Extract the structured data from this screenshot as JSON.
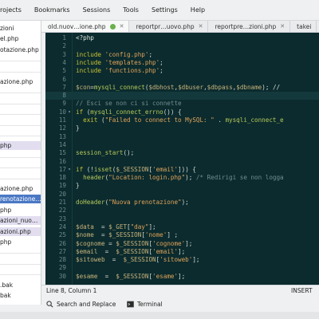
{
  "menu": [
    "rojects",
    "Bookmarks",
    "Sessions",
    "Tools",
    "Settings",
    "Help"
  ],
  "tabs": [
    {
      "label": "old.nuov…ione.php",
      "active": true,
      "modified": true
    },
    {
      "label": "reportpr…uovo.php",
      "active": false
    },
    {
      "label": "reportpre…zioni.php",
      "active": false
    },
    {
      "label": "takei",
      "active": false
    }
  ],
  "sidebar_files": [
    {
      "label": "zioni",
      "state": "normal"
    },
    {
      "label": "el.php",
      "state": "normal"
    },
    {
      "label": "otazione.php",
      "state": "normal"
    },
    {
      "label": "",
      "state": "sep"
    },
    {
      "label": "",
      "state": "sep"
    },
    {
      "label": "azione.php",
      "state": "normal"
    },
    {
      "label": "",
      "state": "sep"
    },
    {
      "label": "",
      "state": "sep"
    },
    {
      "label": "",
      "state": "sep"
    },
    {
      "label": "",
      "state": "sep"
    },
    {
      "label": "",
      "state": "sep"
    },
    {
      "label": "php",
      "state": "highlight"
    },
    {
      "label": "",
      "state": "sep"
    },
    {
      "label": "",
      "state": "sep"
    },
    {
      "label": "",
      "state": "sep"
    },
    {
      "label": "azione.php",
      "state": "normal"
    },
    {
      "label": "renotazione…",
      "state": "selected"
    },
    {
      "label": "php",
      "state": "normal"
    },
    {
      "label": "azioni_nuo…",
      "state": "highlight"
    },
    {
      "label": "azioni.php",
      "state": "highlight"
    },
    {
      "label": "php",
      "state": "normal"
    },
    {
      "label": "",
      "state": "sep"
    },
    {
      "label": "",
      "state": "sep"
    },
    {
      "label": "",
      "state": "sep"
    },
    {
      "label": ".bak",
      "state": "normal"
    },
    {
      "label": "bak",
      "state": "normal"
    }
  ],
  "code_lines": [
    {
      "n": "1",
      "fold": "",
      "tokens": [
        [
          "<?php",
          "pl"
        ]
      ]
    },
    {
      "n": "2",
      "fold": "",
      "tokens": []
    },
    {
      "n": "3",
      "fold": "",
      "tokens": [
        [
          "include ",
          "kw"
        ],
        [
          "'config.php'",
          "str"
        ],
        [
          ";",
          "op"
        ]
      ]
    },
    {
      "n": "4",
      "fold": "",
      "tokens": [
        [
          "include ",
          "kw"
        ],
        [
          "'templates.php'",
          "str"
        ],
        [
          ";",
          "op"
        ]
      ]
    },
    {
      "n": "5",
      "fold": "",
      "tokens": [
        [
          "include ",
          "kw"
        ],
        [
          "'functions.php'",
          "str"
        ],
        [
          ";",
          "op"
        ]
      ]
    },
    {
      "n": "6",
      "fold": "",
      "tokens": []
    },
    {
      "n": "7",
      "fold": "",
      "tokens": [
        [
          "$con",
          "var"
        ],
        [
          "=",
          "op"
        ],
        [
          "mysqli_connect",
          "fn"
        ],
        [
          "(",
          "op"
        ],
        [
          "$dbhost",
          "var"
        ],
        [
          ",",
          "op"
        ],
        [
          "$dbuser",
          "var"
        ],
        [
          ",",
          "op"
        ],
        [
          "$dbpass",
          "var"
        ],
        [
          ",",
          "op"
        ],
        [
          "$dbname",
          "var"
        ],
        [
          "); //",
          "op"
        ]
      ]
    },
    {
      "n": "8",
      "fold": "",
      "tokens": []
    },
    {
      "n": "9",
      "fold": "",
      "tokens": [
        [
          "// Esci se non ci si connette",
          "com"
        ]
      ]
    },
    {
      "n": "10",
      "fold": "▾",
      "tokens": [
        [
          "if ",
          "kw"
        ],
        [
          "(",
          "op"
        ],
        [
          "mysqli_connect_errno",
          "fn"
        ],
        [
          "()) {",
          "op"
        ]
      ]
    },
    {
      "n": "11",
      "fold": "",
      "tokens": [
        [
          "  exit ",
          "kw"
        ],
        [
          "(",
          "op"
        ],
        [
          "\"Failed to connect to MySQL: \"",
          "str"
        ],
        [
          " . ",
          "op"
        ],
        [
          "mysqli_connect_e",
          "fn"
        ]
      ]
    },
    {
      "n": "12",
      "fold": "",
      "tokens": [
        [
          "}",
          "op"
        ]
      ]
    },
    {
      "n": "13",
      "fold": "",
      "tokens": []
    },
    {
      "n": "14",
      "fold": "",
      "tokens": []
    },
    {
      "n": "15",
      "fold": "",
      "tokens": [
        [
          "session_start",
          "fn"
        ],
        [
          "();",
          "op"
        ]
      ]
    },
    {
      "n": "16",
      "fold": "",
      "tokens": []
    },
    {
      "n": "17",
      "fold": "▾",
      "tokens": [
        [
          "if ",
          "kw"
        ],
        [
          "(!",
          "op"
        ],
        [
          "isset",
          "fn"
        ],
        [
          "(",
          "op"
        ],
        [
          "$_SESSION",
          "var"
        ],
        [
          "[",
          "op"
        ],
        [
          "'email'",
          "str"
        ],
        [
          "])) {",
          "op"
        ]
      ]
    },
    {
      "n": "18",
      "fold": "",
      "tokens": [
        [
          "  header",
          "fn"
        ],
        [
          "(",
          "op"
        ],
        [
          "\"Location: login.php\"",
          "str"
        ],
        [
          "); ",
          "op"
        ],
        [
          "/* Redirigi se non logga",
          "com"
        ]
      ]
    },
    {
      "n": "19",
      "fold": "",
      "tokens": [
        [
          "}",
          "op"
        ]
      ]
    },
    {
      "n": "20",
      "fold": "",
      "tokens": []
    },
    {
      "n": "21",
      "fold": "",
      "tokens": [
        [
          "doHeader",
          "fn"
        ],
        [
          "(",
          "op"
        ],
        [
          "\"Nuova prenotazione\"",
          "str"
        ],
        [
          ");",
          "op"
        ]
      ]
    },
    {
      "n": "22",
      "fold": "",
      "tokens": []
    },
    {
      "n": "23",
      "fold": "",
      "tokens": []
    },
    {
      "n": "24",
      "fold": "",
      "tokens": [
        [
          "$data",
          "var"
        ],
        [
          "  = ",
          "op"
        ],
        [
          "$_GET",
          "var"
        ],
        [
          "[",
          "op"
        ],
        [
          "\"day\"",
          "str"
        ],
        [
          "];",
          "op"
        ]
      ]
    },
    {
      "n": "25",
      "fold": "",
      "tokens": [
        [
          "$nome",
          "var"
        ],
        [
          "  = ",
          "op"
        ],
        [
          "$_SESSION",
          "var"
        ],
        [
          "[",
          "op"
        ],
        [
          "'nome'",
          "str"
        ],
        [
          "] ;",
          "op"
        ]
      ]
    },
    {
      "n": "26",
      "fold": "",
      "tokens": [
        [
          "$cognome",
          "var"
        ],
        [
          " = ",
          "op"
        ],
        [
          "$_SESSION",
          "var"
        ],
        [
          "[",
          "op"
        ],
        [
          "'cognome'",
          "str"
        ],
        [
          "];",
          "op"
        ]
      ]
    },
    {
      "n": "27",
      "fold": "",
      "tokens": [
        [
          "$email",
          "var"
        ],
        [
          "  =  ",
          "op"
        ],
        [
          "$_SESSION",
          "var"
        ],
        [
          "[",
          "op"
        ],
        [
          "'email'",
          "str"
        ],
        [
          "];",
          "op"
        ]
      ]
    },
    {
      "n": "28",
      "fold": "",
      "tokens": [
        [
          "$sitoweb",
          "var"
        ],
        [
          "  =  ",
          "op"
        ],
        [
          "$_SESSION",
          "var"
        ],
        [
          "[",
          "op"
        ],
        [
          "'sitoweb'",
          "str"
        ],
        [
          "];",
          "op"
        ]
      ]
    },
    {
      "n": "29",
      "fold": "",
      "tokens": []
    },
    {
      "n": "30",
      "fold": "",
      "tokens": [
        [
          "$esame",
          "var"
        ],
        [
          "  =  ",
          "op"
        ],
        [
          "$_SESSION",
          "var"
        ],
        [
          "[",
          "op"
        ],
        [
          "'esame'",
          "str"
        ],
        [
          "];",
          "op"
        ]
      ]
    }
  ],
  "current_line": "8",
  "status": {
    "position": "Line 8, Column 1",
    "mode": "INSERT"
  },
  "bottom": {
    "search_label": "Search and Replace",
    "terminal_label": "Terminal"
  }
}
